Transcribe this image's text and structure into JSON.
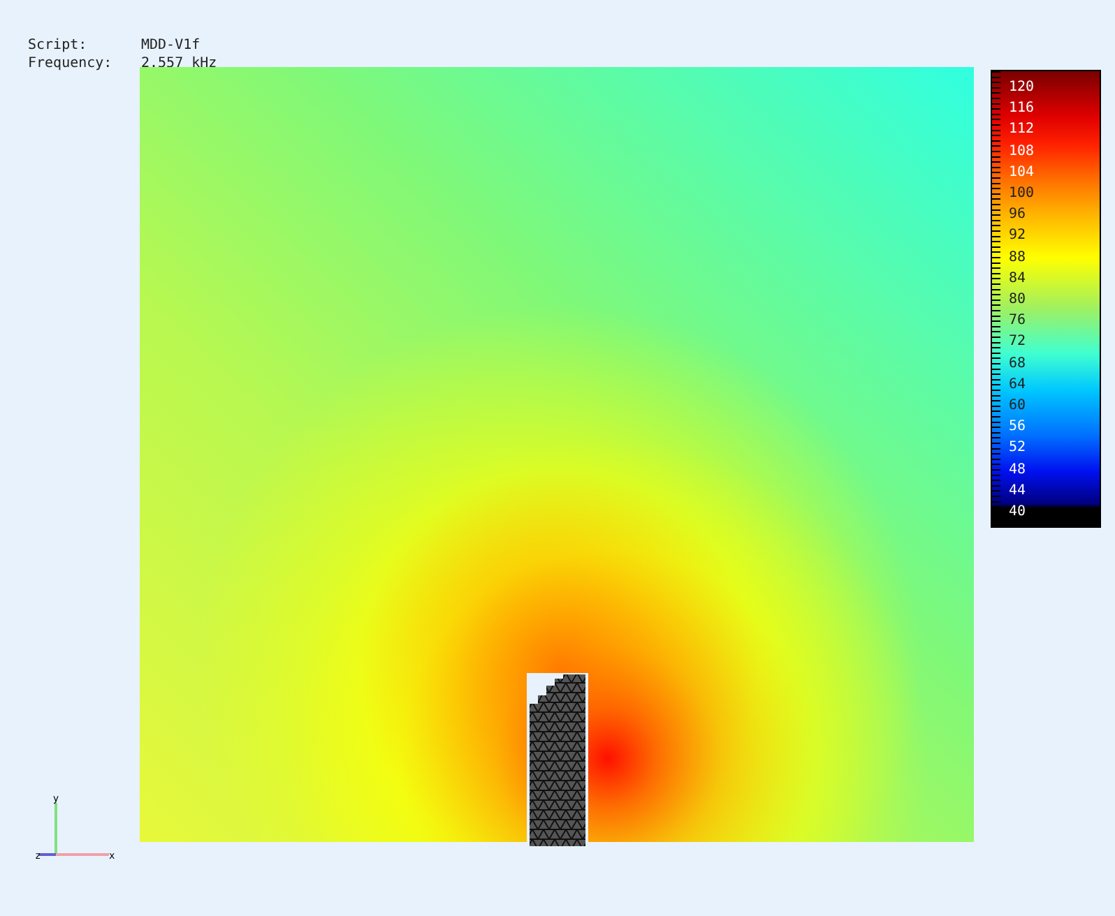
{
  "header": {
    "script_label": "Script:",
    "script_value": "MDD-V1f",
    "frequency_label": "Frequency:",
    "frequency_value": "2.557 kHz"
  },
  "color_scale": {
    "labels": [
      "120",
      "116",
      "112",
      "108",
      "104",
      "100",
      "96",
      "92",
      "88",
      "84",
      "80",
      "76",
      "72",
      "68",
      "64",
      "60",
      "56",
      "52",
      "48",
      "44",
      "40"
    ]
  },
  "axes": {
    "x": "x",
    "y": "y",
    "z": "z"
  }
}
